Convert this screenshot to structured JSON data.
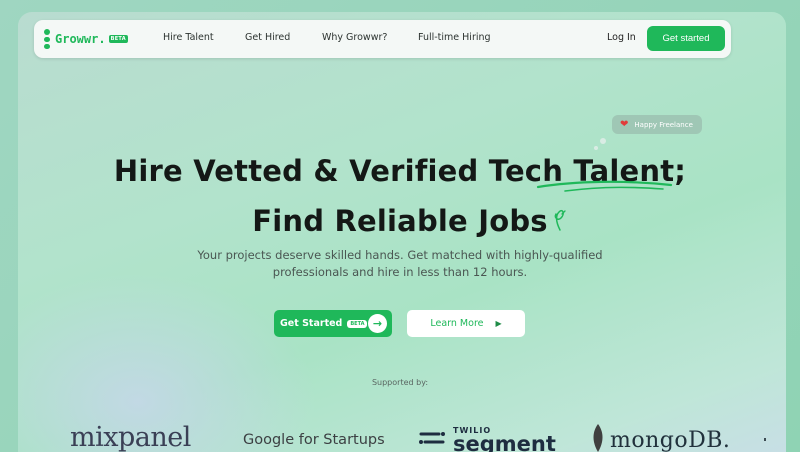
{
  "brand": {
    "name": "Growwr.",
    "tag": "BETA"
  },
  "nav": {
    "links": [
      "Hire Talent",
      "Get Hired",
      "Why Growwr?",
      "Full-time Hiring"
    ],
    "login": "Log In",
    "cta": "Get started"
  },
  "hero": {
    "badge": "Happy Freelance",
    "title_line1": "Hire Vetted & Verified Tech Talent;",
    "title_line2": "Find Reliable Jobs",
    "subtitle_line1": "Your projects deserve skilled hands. Get matched with highly-qualified",
    "subtitle_line2": "professionals and hire in less than 12 hours.",
    "primary_cta": "Get Started",
    "primary_cta_tag": "BETA",
    "secondary_cta": "Learn More"
  },
  "supported": {
    "label": "Supported by:",
    "logos": {
      "mixpanel": "mixpanel",
      "google": "Google for Startups",
      "twilio": "TWILIO",
      "segment": "segment",
      "mongodb": "mongoDB."
    }
  },
  "colors": {
    "accent": "#1fb85a",
    "heading": "#141816",
    "badge_heart": "#e23b3b"
  },
  "icons": [
    "growwr-logo-icon",
    "heart-icon",
    "arrow-right-icon",
    "play-icon",
    "sparkle-icon",
    "segment-logo-icon",
    "mongodb-leaf-icon"
  ]
}
